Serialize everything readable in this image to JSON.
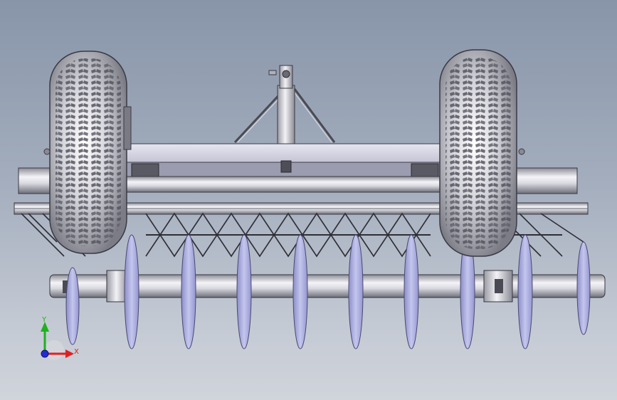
{
  "viewport": {
    "background_top": "#8895a9",
    "background_bottom": "#d0d4db"
  },
  "triad": {
    "x_label": "X",
    "y_label": "Y",
    "x_color": "#e02020",
    "y_color": "#20b020",
    "z_color": "#2030d0"
  },
  "model": {
    "disc_count": 10,
    "wheel_count": 2,
    "disc_color": "#a6a8dc",
    "metal_color": "#dcdce4",
    "tire_color": "#c8c8d0"
  }
}
